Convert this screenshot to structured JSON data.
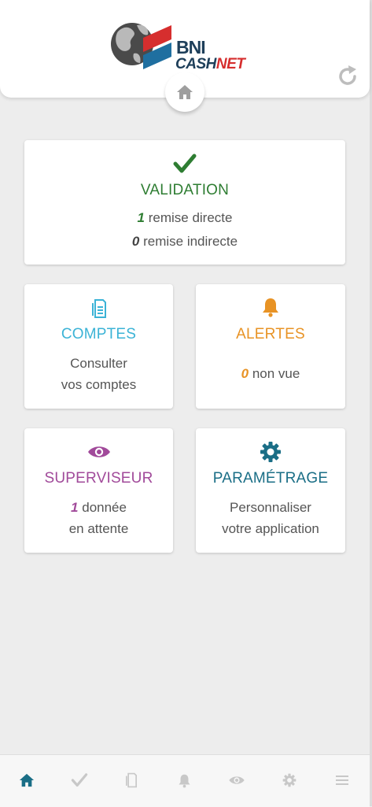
{
  "header": {
    "logo": {
      "line1": "BNI",
      "line2a": "CASH",
      "line2b": "NET"
    },
    "home_icon": "home-icon",
    "refresh_icon": "refresh-icon"
  },
  "cards": {
    "validation": {
      "title": "VALIDATION",
      "line1_num": "1",
      "line1_text": "remise directe",
      "line2_num": "0",
      "line2_text": "remise indirecte",
      "color": "#2e7d32"
    },
    "comptes": {
      "title": "COMPTES",
      "line1": "Consulter",
      "line2": "vos comptes",
      "color": "#3bb3d6"
    },
    "alertes": {
      "title": "ALERTES",
      "num": "0",
      "text": "non vue",
      "color": "#e89325"
    },
    "superviseur": {
      "title": "SUPERVISEUR",
      "num": "1",
      "text": "donnée",
      "line2": "en attente",
      "color": "#a14a9a"
    },
    "parametrage": {
      "title": "PARAMÉTRAGE",
      "line1": "Personnaliser",
      "line2": "votre application",
      "color": "#1a6e86"
    }
  },
  "bottom_nav": [
    "home-icon",
    "check-icon",
    "document-icon",
    "bell-icon",
    "eye-icon",
    "gear-icon",
    "menu-icon"
  ]
}
